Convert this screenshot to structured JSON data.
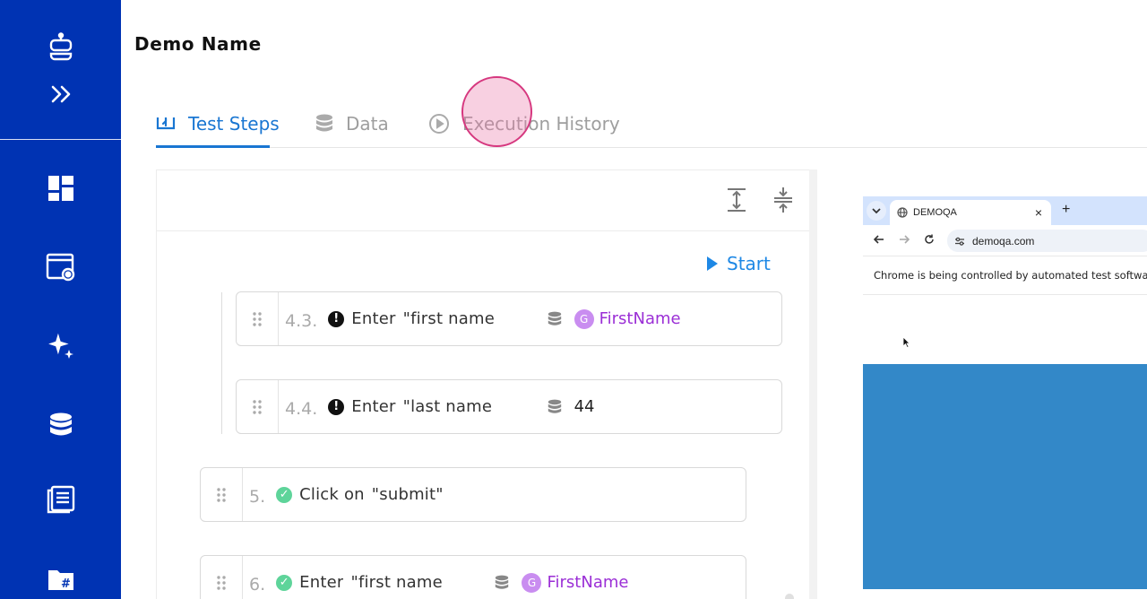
{
  "sidebar": {
    "items": [
      {
        "icon": "robot-icon"
      },
      {
        "icon": "chevrons-right-icon"
      },
      {
        "icon": "dashboard-icon"
      },
      {
        "icon": "window-settings-icon"
      },
      {
        "icon": "sparkles-icon"
      },
      {
        "icon": "database-icon"
      },
      {
        "icon": "reports-icon"
      },
      {
        "icon": "folder-hash-icon"
      }
    ],
    "color": "#0033b3"
  },
  "header": {
    "title": "Demo Name"
  },
  "tabs": [
    {
      "label": "Test Steps",
      "icon": "test-steps-icon",
      "active": true
    },
    {
      "label": "Data",
      "icon": "database-icon",
      "active": false
    },
    {
      "label": "Execution History",
      "icon": "play-circle-icon",
      "active": false
    }
  ],
  "toolbar": {
    "start_label": "Start"
  },
  "steps": [
    {
      "number": "4.3.",
      "status": "error",
      "status_glyph": "!",
      "action": "Enter",
      "target": "\"first name",
      "has_data": true,
      "badge": "G",
      "value": "FirstName",
      "value_type": "variable"
    },
    {
      "number": "4.4.",
      "status": "error",
      "status_glyph": "!",
      "action": "Enter",
      "target": "\"last name",
      "has_data": true,
      "value": "44",
      "value_type": "literal"
    },
    {
      "number": "5.",
      "status": "ok",
      "status_glyph": "✓",
      "action": "Click on",
      "target": "\"submit\""
    },
    {
      "number": "6.",
      "status": "ok",
      "status_glyph": "✓",
      "action": "Enter",
      "target": "\"first name",
      "has_data": true,
      "badge": "G",
      "value": "FirstName",
      "value_type": "variable"
    }
  ],
  "browser": {
    "tab_title": "DEMOQA",
    "new_tab": "+",
    "close_tab": "×",
    "url": "demoqa.com",
    "infobar": "Chrome is being controlled by automated test software."
  },
  "colors": {
    "accent": "#1976d2",
    "variable": "#9b2fd6",
    "error": "#111111",
    "success": "#5ed49a"
  }
}
